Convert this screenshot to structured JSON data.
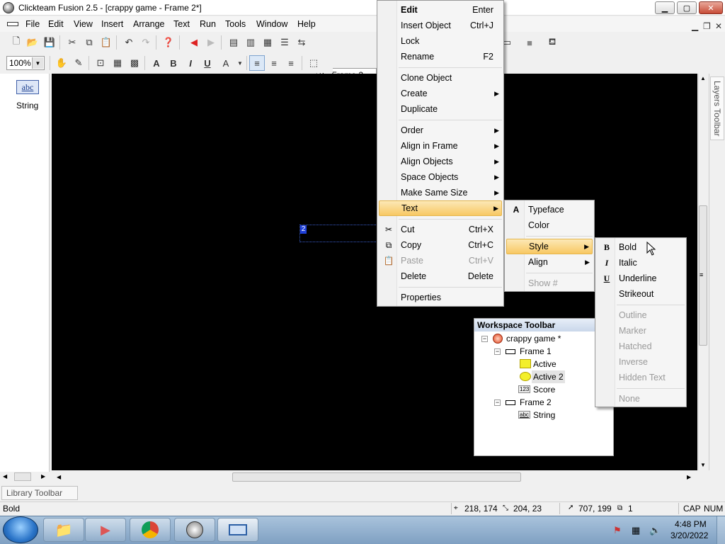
{
  "window": {
    "title": "Clickteam Fusion 2.5 - [crappy game - Frame 2*]",
    "btn_minimize": "▁",
    "btn_maximize": "▢",
    "btn_close": "✕"
  },
  "menubar": {
    "items": [
      "File",
      "Edit",
      "View",
      "Insert",
      "Arrange",
      "Text",
      "Run",
      "Tools",
      "Window",
      "Help"
    ]
  },
  "toolbar": {
    "frame_select": "2 - Frame 2",
    "zoom": "100%"
  },
  "library_panel": {
    "object_icon_text": "abc",
    "object_label": "String"
  },
  "canvas": {
    "selected_object_label": "2"
  },
  "layers_toolbar": {
    "label": "Layers Toolbar"
  },
  "context_menu": {
    "items": [
      {
        "label": "Edit",
        "shortcut": "Enter"
      },
      {
        "label": "Insert Object",
        "shortcut": "Ctrl+J"
      },
      {
        "label": "Lock",
        "shortcut": ""
      },
      {
        "label": "Rename",
        "shortcut": "F2"
      },
      {
        "label": "Clone Object",
        "shortcut": ""
      },
      {
        "label": "Create",
        "shortcut": ""
      },
      {
        "label": "Duplicate",
        "shortcut": ""
      },
      {
        "label": "Order",
        "shortcut": ""
      },
      {
        "label": "Align in Frame",
        "shortcut": ""
      },
      {
        "label": "Align Objects",
        "shortcut": ""
      },
      {
        "label": "Space Objects",
        "shortcut": ""
      },
      {
        "label": "Make Same Size",
        "shortcut": ""
      },
      {
        "label": "Text",
        "shortcut": ""
      },
      {
        "label": "Cut",
        "shortcut": "Ctrl+X"
      },
      {
        "label": "Copy",
        "shortcut": "Ctrl+C"
      },
      {
        "label": "Paste",
        "shortcut": "Ctrl+V"
      },
      {
        "label": "Delete",
        "shortcut": "Delete"
      },
      {
        "label": "Properties",
        "shortcut": ""
      }
    ]
  },
  "text_submenu": {
    "items": [
      "Typeface",
      "Color",
      "Style",
      "Align",
      "Show #"
    ]
  },
  "style_submenu": {
    "items": [
      "Bold",
      "Italic",
      "Underline",
      "Strikeout",
      "Outline",
      "Marker",
      "Hatched",
      "Inverse",
      "Hidden Text",
      "None"
    ],
    "icons": {
      "bold": "B",
      "italic": "I",
      "underline": "U"
    }
  },
  "workspace": {
    "title": "Workspace Toolbar",
    "tree": {
      "app": "crappy game *",
      "frame1": "Frame 1",
      "active": "Active",
      "active2": "Active 2",
      "score": "Score",
      "score_icon": "123",
      "frame2": "Frame 2",
      "string": "String",
      "string_icon": "abc"
    }
  },
  "library_toolbar": {
    "label": "Library Toolbar"
  },
  "statusbar": {
    "message": "Bold",
    "position": "218, 174",
    "size": "204, 23",
    "mouse": "707, 199",
    "count": "1",
    "cap": "CAP",
    "num": "NUM"
  },
  "taskbar": {
    "time": "4:48 PM",
    "date": "3/20/2022"
  },
  "colors": {
    "highlight": "#f8c863",
    "canvas": "#000000",
    "selection": "#1f3fd7"
  }
}
